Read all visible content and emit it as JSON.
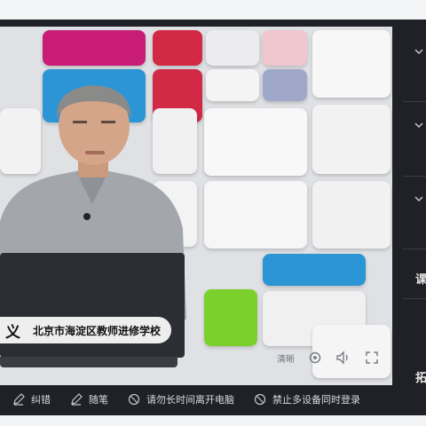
{
  "video": {
    "caption_name": "义",
    "caption_school": "北京市海淀区教师进修学校",
    "controls": {
      "quality_label": "清晰",
      "settings_icon": "gear-icon",
      "volume_icon": "speaker-icon",
      "fullscreen_icon": "fullscreen-icon"
    }
  },
  "sidebar": {
    "section_label_1": "课",
    "section_label_2": "拓",
    "chevron_icon": "chevron-down-icon"
  },
  "bottom_bar": {
    "items": [
      {
        "label": "纠错",
        "icon": "edit-icon"
      },
      {
        "label": "随笔",
        "icon": "note-icon"
      },
      {
        "label": "请勿长时间离开电脑",
        "icon": "no-icon"
      },
      {
        "label": "禁止多设备同时登录",
        "icon": "no-icon"
      }
    ]
  },
  "colors": {
    "app_bg": "#1f2126",
    "accent_red": "#d22a46",
    "accent_magenta": "#c81c78",
    "accent_blue": "#2b95d6",
    "accent_green": "#7bd02c"
  }
}
